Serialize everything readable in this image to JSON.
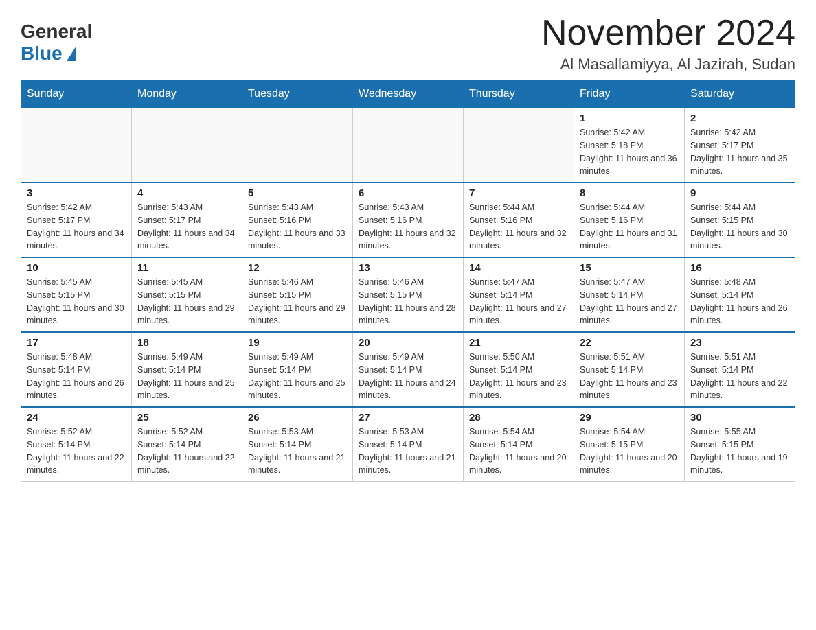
{
  "header": {
    "logo_general": "General",
    "logo_blue": "Blue",
    "month_title": "November 2024",
    "location": "Al Masallamiyya, Al Jazirah, Sudan"
  },
  "days_of_week": [
    "Sunday",
    "Monday",
    "Tuesday",
    "Wednesday",
    "Thursday",
    "Friday",
    "Saturday"
  ],
  "weeks": [
    [
      {
        "day": "",
        "info": ""
      },
      {
        "day": "",
        "info": ""
      },
      {
        "day": "",
        "info": ""
      },
      {
        "day": "",
        "info": ""
      },
      {
        "day": "",
        "info": ""
      },
      {
        "day": "1",
        "info": "Sunrise: 5:42 AM\nSunset: 5:18 PM\nDaylight: 11 hours and 36 minutes."
      },
      {
        "day": "2",
        "info": "Sunrise: 5:42 AM\nSunset: 5:17 PM\nDaylight: 11 hours and 35 minutes."
      }
    ],
    [
      {
        "day": "3",
        "info": "Sunrise: 5:42 AM\nSunset: 5:17 PM\nDaylight: 11 hours and 34 minutes."
      },
      {
        "day": "4",
        "info": "Sunrise: 5:43 AM\nSunset: 5:17 PM\nDaylight: 11 hours and 34 minutes."
      },
      {
        "day": "5",
        "info": "Sunrise: 5:43 AM\nSunset: 5:16 PM\nDaylight: 11 hours and 33 minutes."
      },
      {
        "day": "6",
        "info": "Sunrise: 5:43 AM\nSunset: 5:16 PM\nDaylight: 11 hours and 32 minutes."
      },
      {
        "day": "7",
        "info": "Sunrise: 5:44 AM\nSunset: 5:16 PM\nDaylight: 11 hours and 32 minutes."
      },
      {
        "day": "8",
        "info": "Sunrise: 5:44 AM\nSunset: 5:16 PM\nDaylight: 11 hours and 31 minutes."
      },
      {
        "day": "9",
        "info": "Sunrise: 5:44 AM\nSunset: 5:15 PM\nDaylight: 11 hours and 30 minutes."
      }
    ],
    [
      {
        "day": "10",
        "info": "Sunrise: 5:45 AM\nSunset: 5:15 PM\nDaylight: 11 hours and 30 minutes."
      },
      {
        "day": "11",
        "info": "Sunrise: 5:45 AM\nSunset: 5:15 PM\nDaylight: 11 hours and 29 minutes."
      },
      {
        "day": "12",
        "info": "Sunrise: 5:46 AM\nSunset: 5:15 PM\nDaylight: 11 hours and 29 minutes."
      },
      {
        "day": "13",
        "info": "Sunrise: 5:46 AM\nSunset: 5:15 PM\nDaylight: 11 hours and 28 minutes."
      },
      {
        "day": "14",
        "info": "Sunrise: 5:47 AM\nSunset: 5:14 PM\nDaylight: 11 hours and 27 minutes."
      },
      {
        "day": "15",
        "info": "Sunrise: 5:47 AM\nSunset: 5:14 PM\nDaylight: 11 hours and 27 minutes."
      },
      {
        "day": "16",
        "info": "Sunrise: 5:48 AM\nSunset: 5:14 PM\nDaylight: 11 hours and 26 minutes."
      }
    ],
    [
      {
        "day": "17",
        "info": "Sunrise: 5:48 AM\nSunset: 5:14 PM\nDaylight: 11 hours and 26 minutes."
      },
      {
        "day": "18",
        "info": "Sunrise: 5:49 AM\nSunset: 5:14 PM\nDaylight: 11 hours and 25 minutes."
      },
      {
        "day": "19",
        "info": "Sunrise: 5:49 AM\nSunset: 5:14 PM\nDaylight: 11 hours and 25 minutes."
      },
      {
        "day": "20",
        "info": "Sunrise: 5:49 AM\nSunset: 5:14 PM\nDaylight: 11 hours and 24 minutes."
      },
      {
        "day": "21",
        "info": "Sunrise: 5:50 AM\nSunset: 5:14 PM\nDaylight: 11 hours and 23 minutes."
      },
      {
        "day": "22",
        "info": "Sunrise: 5:51 AM\nSunset: 5:14 PM\nDaylight: 11 hours and 23 minutes."
      },
      {
        "day": "23",
        "info": "Sunrise: 5:51 AM\nSunset: 5:14 PM\nDaylight: 11 hours and 22 minutes."
      }
    ],
    [
      {
        "day": "24",
        "info": "Sunrise: 5:52 AM\nSunset: 5:14 PM\nDaylight: 11 hours and 22 minutes."
      },
      {
        "day": "25",
        "info": "Sunrise: 5:52 AM\nSunset: 5:14 PM\nDaylight: 11 hours and 22 minutes."
      },
      {
        "day": "26",
        "info": "Sunrise: 5:53 AM\nSunset: 5:14 PM\nDaylight: 11 hours and 21 minutes."
      },
      {
        "day": "27",
        "info": "Sunrise: 5:53 AM\nSunset: 5:14 PM\nDaylight: 11 hours and 21 minutes."
      },
      {
        "day": "28",
        "info": "Sunrise: 5:54 AM\nSunset: 5:14 PM\nDaylight: 11 hours and 20 minutes."
      },
      {
        "day": "29",
        "info": "Sunrise: 5:54 AM\nSunset: 5:15 PM\nDaylight: 11 hours and 20 minutes."
      },
      {
        "day": "30",
        "info": "Sunrise: 5:55 AM\nSunset: 5:15 PM\nDaylight: 11 hours and 19 minutes."
      }
    ]
  ]
}
